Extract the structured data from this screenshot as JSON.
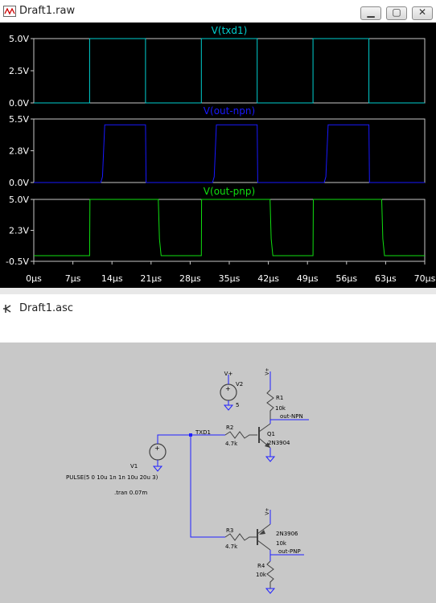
{
  "waveform_window": {
    "title": "Draft1.raw",
    "buttons": {
      "minimize": "▁",
      "restore": "▢",
      "close": "✕"
    }
  },
  "schematic_window": {
    "title": "Draft1.asc"
  },
  "colors": {
    "plot_bg": "#000000",
    "txd1": "#00d0d0",
    "npn": "#1818ff",
    "pnp": "#10e010",
    "axis_text": "#ffffff",
    "grid": "#c8c8c8",
    "wire": "#2020ff",
    "part": "#404040",
    "ground": "#2020ff"
  },
  "chart_data": {
    "type": "line",
    "x_ticks": [
      "0µs",
      "7µs",
      "14µs",
      "21µs",
      "28µs",
      "35µs",
      "42µs",
      "49µs",
      "56µs",
      "63µs",
      "70µs"
    ],
    "xlim": [
      0,
      70
    ],
    "panes": [
      {
        "title": "V(txd1)",
        "yticks": [
          "5.0V",
          "2.5V",
          "0.0V"
        ],
        "ylim": [
          0,
          5
        ],
        "points": [
          [
            0,
            0
          ],
          [
            10,
            0
          ],
          [
            10,
            5
          ],
          [
            20,
            5
          ],
          [
            20,
            0
          ],
          [
            30,
            0
          ],
          [
            30,
            5
          ],
          [
            40,
            5
          ],
          [
            40,
            0
          ],
          [
            50,
            0
          ],
          [
            50,
            5
          ],
          [
            60,
            5
          ],
          [
            60,
            0
          ],
          [
            70,
            0
          ]
        ]
      },
      {
        "title": "V(out-npn)",
        "yticks": [
          "5.5V",
          "2.8V",
          "0.0V"
        ],
        "ylim": [
          0,
          5.5
        ],
        "points": [
          [
            0,
            0
          ],
          [
            12,
            0
          ],
          [
            12.3,
            0.5
          ],
          [
            12.7,
            5
          ],
          [
            20,
            5
          ],
          [
            20.1,
            0
          ],
          [
            32,
            0
          ],
          [
            32.3,
            0.5
          ],
          [
            32.7,
            5
          ],
          [
            40,
            5
          ],
          [
            40.1,
            0
          ],
          [
            52,
            0
          ],
          [
            52.3,
            0.5
          ],
          [
            52.7,
            5
          ],
          [
            60,
            5
          ],
          [
            60.1,
            0
          ],
          [
            70,
            0
          ]
        ]
      },
      {
        "title": "V(out-pnp)",
        "yticks": [
          "5.0V",
          "2.3V",
          "-0.5V"
        ],
        "ylim": [
          -0.5,
          5
        ],
        "points": [
          [
            0,
            0
          ],
          [
            10,
            0
          ],
          [
            10.05,
            5
          ],
          [
            22.3,
            5
          ],
          [
            22.5,
            1.5
          ],
          [
            22.8,
            0
          ],
          [
            30,
            0
          ],
          [
            30.05,
            5
          ],
          [
            42.3,
            5
          ],
          [
            42.5,
            1.5
          ],
          [
            42.8,
            0
          ],
          [
            50,
            0
          ],
          [
            50.05,
            5
          ],
          [
            62.3,
            5
          ],
          [
            62.5,
            1.5
          ],
          [
            62.8,
            0
          ],
          [
            70,
            0
          ]
        ]
      }
    ]
  },
  "schematic": {
    "v2": {
      "name": "V2",
      "value": "5"
    },
    "v1": {
      "name": "V1",
      "value": "PULSE(5 0 10u 1n 1n 10u 20u 3)"
    },
    "tran": ".tran 0.07m",
    "net_txd1": "TXD1",
    "r1": {
      "name": "R1",
      "value": "10k"
    },
    "r2": {
      "name": "R2",
      "value": "4.7k"
    },
    "r3": {
      "name": "R3",
      "value": "4.7k"
    },
    "r4": {
      "name": "R4",
      "value": "10k"
    },
    "q1": {
      "name": "Q1",
      "value": "2N3904"
    },
    "q2": {
      "value": "2N3906"
    },
    "label_npn": "out-NPN",
    "label_pnp": "out-PNP",
    "vplus": "V+"
  }
}
